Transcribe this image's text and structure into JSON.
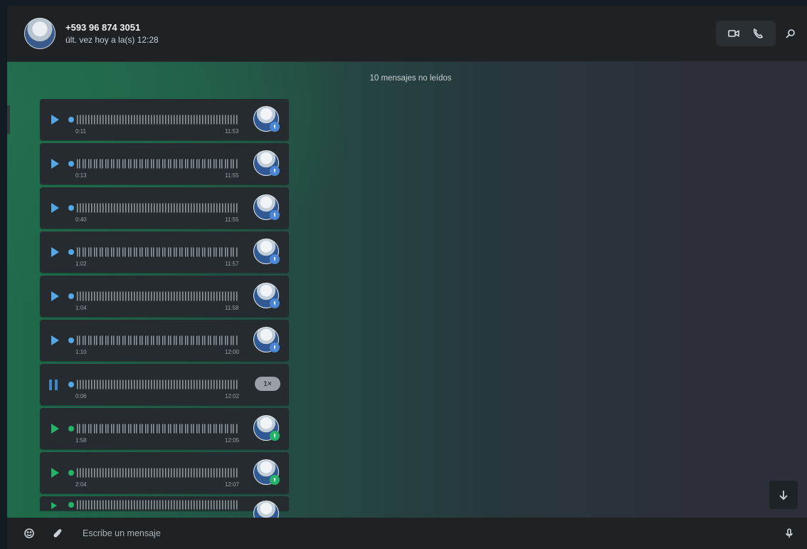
{
  "header": {
    "contact_name": "+593 96 874 3051",
    "last_seen": "últ. vez hoy a la(s) 12:28",
    "icons": [
      "video-call-icon",
      "voice-call-icon",
      "search-icon"
    ]
  },
  "chat": {
    "unread_banner": "10 mensajes no leídos",
    "messages": [
      {
        "duration": "0:11",
        "time": "11:53",
        "status": "blue",
        "playing": false
      },
      {
        "duration": "0:13",
        "time": "11:55",
        "status": "blue",
        "playing": false
      },
      {
        "duration": "0:40",
        "time": "11:55",
        "status": "blue",
        "playing": false
      },
      {
        "duration": "1:02",
        "time": "11:57",
        "status": "blue",
        "playing": false
      },
      {
        "duration": "1:04",
        "time": "11:58",
        "status": "blue",
        "playing": false
      },
      {
        "duration": "1:10",
        "time": "12:00",
        "status": "blue",
        "playing": false
      },
      {
        "duration": "0:06",
        "time": "12:02",
        "status": "playing",
        "playing": true,
        "speed": "1×"
      },
      {
        "duration": "1:58",
        "time": "12:05",
        "status": "green",
        "playing": false
      },
      {
        "duration": "2:04",
        "time": "12:07",
        "status": "green",
        "playing": false
      }
    ]
  },
  "composer": {
    "placeholder": "Escribe un mensaje",
    "icons": [
      "emoji-icon",
      "attach-icon",
      "microphone-icon"
    ]
  },
  "colors": {
    "accent_blue": "#53a8e5",
    "accent_green": "#25b36a"
  }
}
